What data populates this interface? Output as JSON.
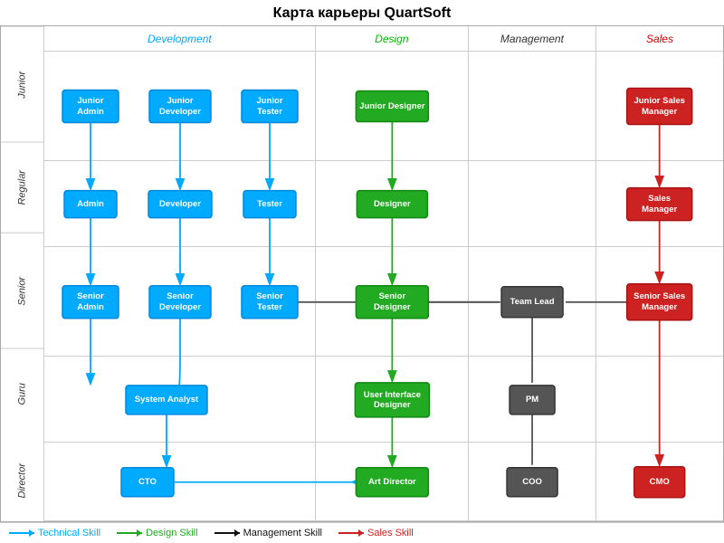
{
  "title": "Карта карьеры QuartSoft",
  "columns": [
    {
      "label": "Development",
      "class": "col-dev",
      "color": "#00aaff"
    },
    {
      "label": "Design",
      "class": "col-design",
      "color": "#00bb00"
    },
    {
      "label": "Management",
      "class": "col-mgmt",
      "color": "#333"
    },
    {
      "label": "Sales",
      "class": "col-sales",
      "color": "#cc0000"
    }
  ],
  "rows": [
    {
      "label": "Junior"
    },
    {
      "label": "Regular"
    },
    {
      "label": "Senior"
    },
    {
      "label": "Guru"
    },
    {
      "label": "Director"
    }
  ],
  "nodes": {
    "junior_admin": {
      "label": "Junior\nAdmin",
      "type": "blue"
    },
    "junior_developer": {
      "label": "Junior\nDeveloper",
      "type": "blue"
    },
    "junior_tester": {
      "label": "Junior\nTester",
      "type": "blue"
    },
    "junior_designer": {
      "label": "Junior Designer",
      "type": "green"
    },
    "junior_sales": {
      "label": "Junior Sales\nManager",
      "type": "red"
    },
    "admin": {
      "label": "Admin",
      "type": "blue"
    },
    "developer": {
      "label": "Developer",
      "type": "blue"
    },
    "tester": {
      "label": "Tester",
      "type": "blue"
    },
    "designer": {
      "label": "Designer",
      "type": "green"
    },
    "sales_manager": {
      "label": "Sales\nManager",
      "type": "red"
    },
    "senior_admin": {
      "label": "Senior\nAdmin",
      "type": "blue"
    },
    "senior_developer": {
      "label": "Senior\nDeveloper",
      "type": "blue"
    },
    "senior_tester": {
      "label": "Senior\nTester",
      "type": "blue"
    },
    "senior_designer": {
      "label": "Senior\nDesigner",
      "type": "green"
    },
    "senior_sales": {
      "label": "Senior Sales\nManager",
      "type": "red"
    },
    "team_lead": {
      "label": "Team Lead",
      "type": "dark"
    },
    "system_analyst": {
      "label": "System Analyst",
      "type": "blue"
    },
    "ui_designer": {
      "label": "User Interface\nDesigner",
      "type": "green"
    },
    "pm": {
      "label": "PM",
      "type": "dark"
    },
    "cto": {
      "label": "CTO",
      "type": "blue"
    },
    "art_director": {
      "label": "Art Director",
      "type": "green"
    },
    "coo": {
      "label": "COO",
      "type": "dark"
    },
    "cmo": {
      "label": "CMO",
      "type": "red"
    }
  },
  "legend": [
    {
      "arrow_class": "la-blue",
      "text": "Technical Skill",
      "text_class": "legend-text-blue"
    },
    {
      "arrow_class": "la-green",
      "text": "Design Skill",
      "text_class": "legend-text-green"
    },
    {
      "arrow_class": "la-black",
      "text": "Management Skill",
      "text_class": "legend-text-black"
    },
    {
      "arrow_class": "la-red",
      "text": "Sales Skill",
      "text_class": "legend-text-red"
    }
  ]
}
